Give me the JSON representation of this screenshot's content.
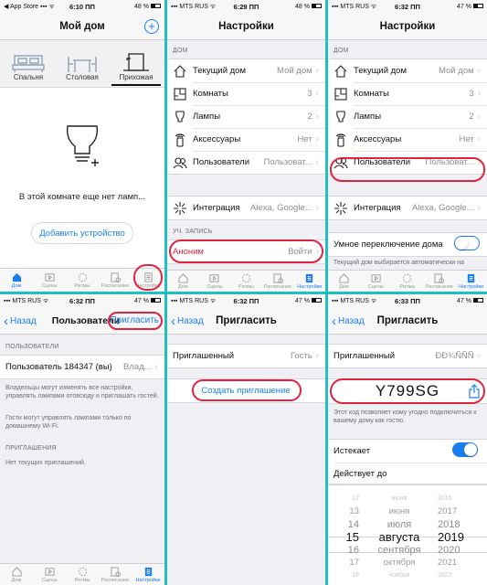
{
  "colors": {
    "accent": "#1a7ef2",
    "highlight": "#e0243f",
    "divider": "#1ec0c0",
    "toggle_on": "#1a7ef2"
  },
  "panel1": {
    "status": {
      "left": "◀ App Store ▪▪▪ ᯤ",
      "time": "6:10 ПП",
      "batt": "48 %"
    },
    "title": "Мой дом",
    "rooms": [
      "Спальня",
      "Столовая",
      "Прихожая"
    ],
    "empty_text": "В этой комнате еще нет ламп...",
    "add_button": "Добавить устройство",
    "tabs": [
      "Дом",
      "Сцены",
      "Ритмы",
      "Расписание",
      "Настройки"
    ]
  },
  "panel2": {
    "status": {
      "left": "▪▪▪ MTS RUS ᯤ",
      "time": "6:29 ПП",
      "batt": "48 %"
    },
    "title": "Настройки",
    "section_home": "ДОМ",
    "rows": [
      {
        "label": "Текущий дом",
        "value": "Мой дом"
      },
      {
        "label": "Комнаты",
        "value": "3"
      },
      {
        "label": "Лампы",
        "value": "2"
      },
      {
        "label": "Аксессуары",
        "value": "Нет"
      },
      {
        "label": "Пользователи",
        "value": "Пользоват..."
      }
    ],
    "integration": {
      "label": "Интеграция",
      "value": "Alexa, Google..."
    },
    "section_account": "УЧ. ЗАПИСЬ",
    "account": {
      "label": "Аноним",
      "value": "Войти"
    },
    "tabs": [
      "Дом",
      "Сцены",
      "Ритмы",
      "Расписание",
      "Настройки"
    ]
  },
  "panel3": {
    "status": {
      "left": "▪▪▪ MTS RUS ᯤ",
      "time": "6:32 ПП",
      "batt": "47 %"
    },
    "title": "Настройки",
    "section_home": "ДОМ",
    "rows": [
      {
        "label": "Текущий дом",
        "value": "Мой дом"
      },
      {
        "label": "Комнаты",
        "value": "3"
      },
      {
        "label": "Лампы",
        "value": "2"
      },
      {
        "label": "Аксессуары",
        "value": "Нет"
      },
      {
        "label": "Пользователи",
        "value": "Пользоват..."
      }
    ],
    "integration": {
      "label": "Интеграция",
      "value": "Alexa, Google..."
    },
    "smart_switch": "Умное переключение дома",
    "smart_note": "Текущий дом выбирается автоматически на",
    "tabs": [
      "Дом",
      "Сцены",
      "Ритмы",
      "Расписание",
      "Настройки"
    ]
  },
  "panel4": {
    "status": {
      "left": "▪▪▪ MTS RUS ᯤ",
      "time": "6:32 ПП",
      "batt": "47 %"
    },
    "back": "Назад",
    "title": "Пользователи",
    "invite": "Пригласить",
    "section_users": "ПОЛЬЗОВАТЕЛИ",
    "user": {
      "label": "Пользователь 184347 (вы)",
      "value": "Влад..."
    },
    "note1": "Владельцы могут изменять все настройки, управлять лампами отовсюду и приглашать гостей.",
    "note2": "Гости могут управлять лампами только по домашнему Wi-Fi.",
    "section_invites": "ПРИГЛАШЕНИЯ",
    "no_invites": "Нет текущих приглашений.",
    "tabs": [
      "Дом",
      "Сцены",
      "Ритмы",
      "Расписание",
      "Настройки"
    ]
  },
  "panel5": {
    "status": {
      "left": "▪▪▪ MTS RUS ᯤ",
      "time": "6:32 ПП",
      "batt": "47 %"
    },
    "back": "Назад",
    "title": "Пригласить",
    "invited": {
      "label": "Приглашенный",
      "value": "Гость"
    },
    "create": "Создать приглашение"
  },
  "panel6": {
    "status": {
      "left": "▪▪▪ MTS RUS ᯤ",
      "time": "6:33 ПП",
      "batt": "47 %"
    },
    "back": "Назад",
    "title": "Пригласить",
    "invited": {
      "label": "Приглашенный",
      "value": "ÐÐ¾ÑÑÑ"
    },
    "code": "Y799SG",
    "code_note": "Этот код позволяет кому угодно подключиться к вашему дому как гостю.",
    "expires": "Истекает",
    "valid_until": "Действует до",
    "picker": {
      "days": [
        "12",
        "13",
        "14",
        "15",
        "16",
        "17",
        "18"
      ],
      "months": [
        "июня",
        "июня",
        "июля",
        "августа",
        "сентября",
        "октября",
        "ноября"
      ],
      "years": [
        "2016",
        "2017",
        "2018",
        "2019",
        "2020",
        "2021",
        "2022"
      ]
    }
  }
}
